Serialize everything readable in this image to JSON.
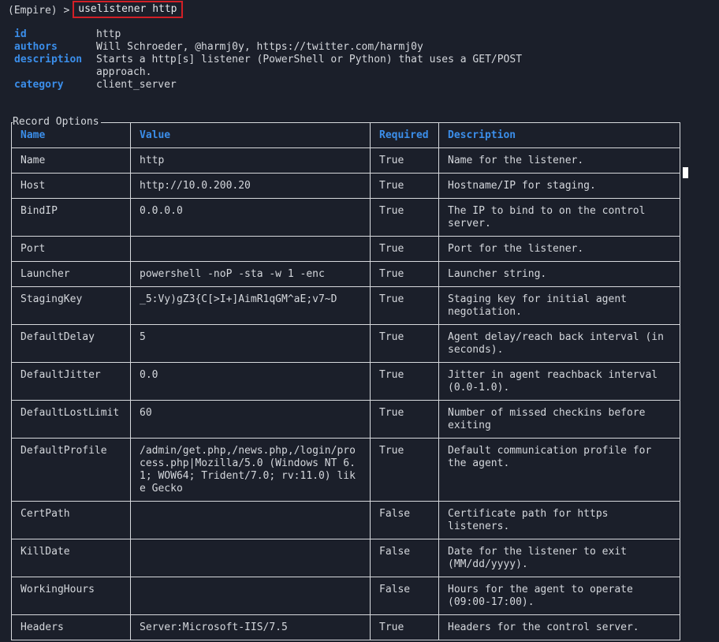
{
  "prompt": {
    "prefix": "(Empire) >",
    "command": "uselistener http"
  },
  "info": [
    {
      "key": "id",
      "value": "http"
    },
    {
      "key": "authors",
      "value": "Will Schroeder, @harmj0y, https://twitter.com/harmj0y"
    },
    {
      "key": "description",
      "value": "Starts a http[s] listener (PowerShell or Python) that uses a GET/POST approach."
    },
    {
      "key": "category",
      "value": "client_server"
    }
  ],
  "options": {
    "title": "Record Options",
    "headers": [
      "Name",
      "Value",
      "Required",
      "Description"
    ],
    "rows": [
      [
        "Name",
        "http",
        "True",
        "Name for the listener."
      ],
      [
        "Host",
        "http://10.0.200.20",
        "True",
        "Hostname/IP for staging."
      ],
      [
        "BindIP",
        "0.0.0.0",
        "True",
        "The IP to bind to on the control server."
      ],
      [
        "Port",
        "",
        "True",
        "Port for the listener."
      ],
      [
        "Launcher",
        "powershell -noP -sta -w 1 -enc",
        "True",
        "Launcher string."
      ],
      [
        "StagingKey",
        "_5:Vy)gZ3{C[>I+]AimR1qGM^aE;v7~D",
        "True",
        "Staging key for initial agent negotiation."
      ],
      [
        "DefaultDelay",
        "5",
        "True",
        "Agent delay/reach back interval (in seconds)."
      ],
      [
        "DefaultJitter",
        "0.0",
        "True",
        "Jitter in agent reachback interval (0.0-1.0)."
      ],
      [
        "DefaultLostLimit",
        "60",
        "True",
        "Number of missed checkins before exiting"
      ],
      [
        "DefaultProfile",
        "/admin/get.php,/news.php,/login/process.php|Mozilla/5.0 (Windows NT 6.1; WOW64; Trident/7.0; rv:11.0) like Gecko",
        "True",
        "Default communication profile for the agent."
      ],
      [
        "CertPath",
        "",
        "False",
        "Certificate path for https listeners."
      ],
      [
        "KillDate",
        "",
        "False",
        "Date for the listener to exit (MM/dd/yyyy)."
      ],
      [
        "WorkingHours",
        "",
        "False",
        "Hours for the agent to operate (09:00-17:00)."
      ],
      [
        "Headers",
        "Server:Microsoft-IIS/7.5",
        "True",
        "Headers for the control server."
      ]
    ]
  },
  "colors": {
    "background": "#1b1f2a",
    "text": "#d4d7dc",
    "accent": "#3b8eea",
    "highlight_box": "#d11f26"
  }
}
